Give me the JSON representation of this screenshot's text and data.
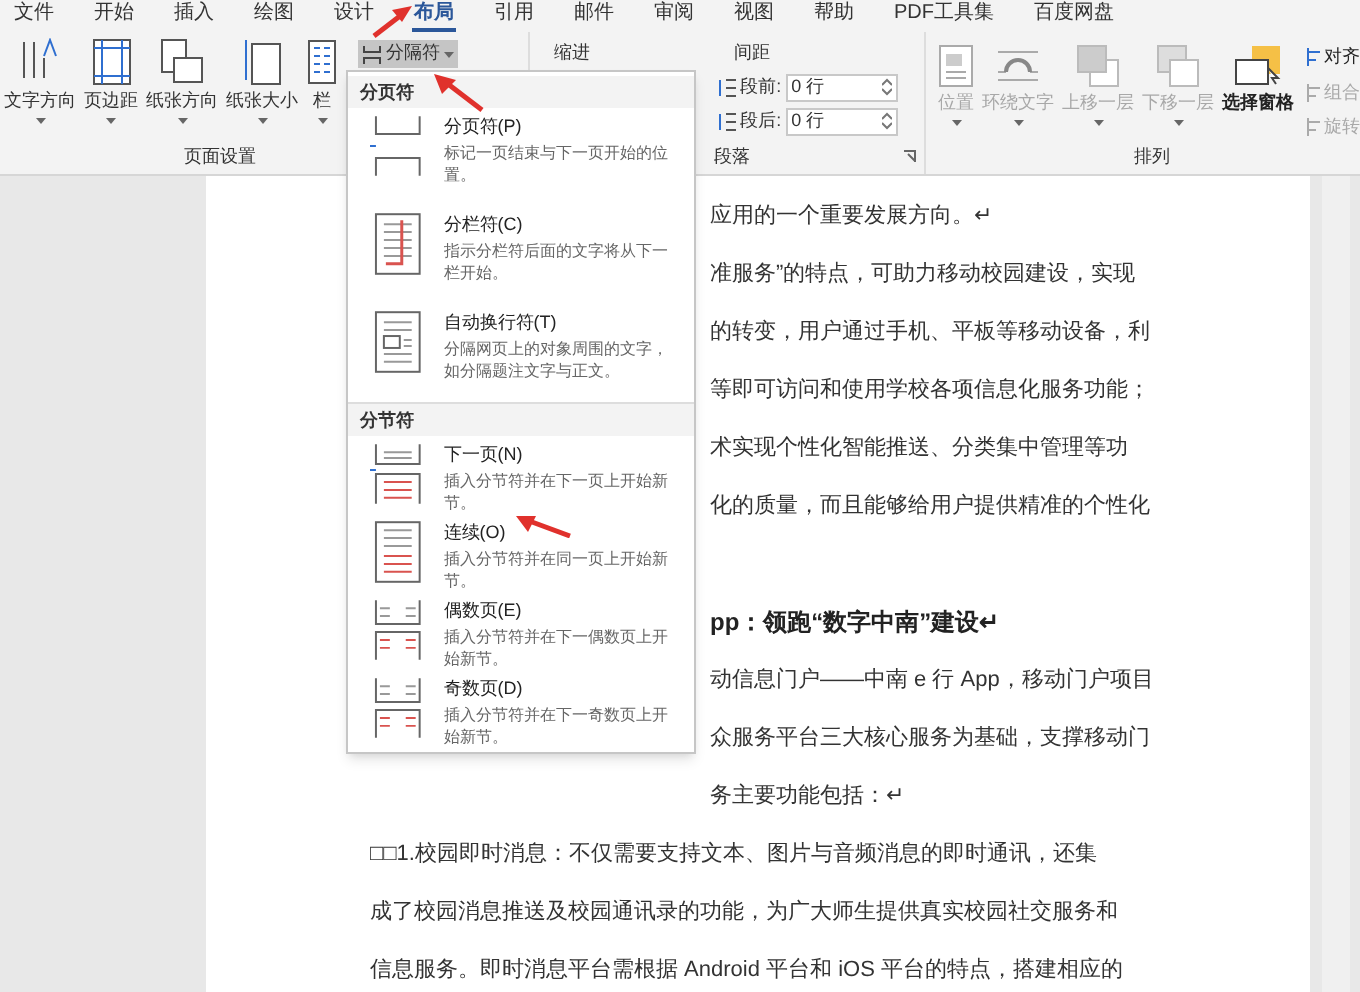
{
  "tabs": [
    {
      "label": "文件",
      "selected": false
    },
    {
      "label": "开始",
      "selected": false
    },
    {
      "label": "插入",
      "selected": false
    },
    {
      "label": "绘图",
      "selected": false
    },
    {
      "label": "设计",
      "selected": false
    },
    {
      "label": "布局",
      "selected": true
    },
    {
      "label": "引用",
      "selected": false
    },
    {
      "label": "邮件",
      "selected": false
    },
    {
      "label": "审阅",
      "selected": false
    },
    {
      "label": "视图",
      "selected": false
    },
    {
      "label": "帮助",
      "selected": false
    },
    {
      "label": "PDF工具集",
      "selected": false
    },
    {
      "label": "百度网盘",
      "selected": false
    }
  ],
  "page_setup": {
    "label": "页面设置",
    "buttons": [
      {
        "label": "文字方向",
        "kind": "text-direction"
      },
      {
        "label": "页边距",
        "kind": "margins"
      },
      {
        "label": "纸张方向",
        "kind": "orientation"
      },
      {
        "label": "纸张大小",
        "kind": "size"
      },
      {
        "label": "栏",
        "kind": "columns"
      }
    ],
    "breaks_button": {
      "label": "分隔符",
      "pressed": true
    }
  },
  "paragraph": {
    "label": "段落",
    "indent_label": "缩进",
    "spacing_label": "间距",
    "before": {
      "label": "段前:",
      "value": "0 行"
    },
    "after": {
      "label": "段后:",
      "value": "0 行"
    }
  },
  "arrange": {
    "label": "排列",
    "buttons": [
      {
        "label": "位置",
        "disabled": true,
        "kind": "position"
      },
      {
        "label": "环绕文字",
        "disabled": true,
        "kind": "wrap"
      },
      {
        "label": "上移一层",
        "disabled": true,
        "kind": "forward"
      },
      {
        "label": "下移一层",
        "disabled": true,
        "kind": "backward"
      },
      {
        "label": "选择窗格",
        "disabled": false,
        "kind": "pane"
      }
    ],
    "small": [
      {
        "label": "对齐",
        "disabled": false
      },
      {
        "label": "组合",
        "disabled": true
      },
      {
        "label": "旋转",
        "disabled": true
      }
    ]
  },
  "breaks_menu": {
    "sections": [
      {
        "title": "分页符",
        "items": [
          {
            "title": "分页符(P)",
            "description": "标记一页结束与下一页开始的位置。",
            "kind": "page"
          },
          {
            "title": "分栏符(C)",
            "description": "指示分栏符后面的文字将从下一栏开始。",
            "kind": "column"
          },
          {
            "title": "自动换行符(T)",
            "description": "分隔网页上的对象周围的文字，如分隔题注文字与正文。",
            "kind": "wrap"
          }
        ]
      },
      {
        "title": "分节符",
        "items": [
          {
            "title": "下一页(N)",
            "description": "插入分节符并在下一页上开始新节。",
            "kind": "next"
          },
          {
            "title": "连续(O)",
            "description": "插入分节符并在同一页上开始新节。",
            "kind": "continuous"
          },
          {
            "title": "偶数页(E)",
            "description": "插入分节符并在下一偶数页上开始新节。",
            "kind": "even"
          },
          {
            "title": "奇数页(D)",
            "description": "插入分节符并在下一奇数页上开始新节。",
            "kind": "odd"
          }
        ]
      }
    ]
  },
  "document": {
    "lines_beside_menu": [
      {
        "text": "应用的一个重要发展方向。↵",
        "kind": "body"
      },
      {
        "text": "准服务”的特点，可助力移动校园建设，实现",
        "kind": "body"
      },
      {
        "text": "的转变，用户通过手机、平板等移动设备，利",
        "kind": "body"
      },
      {
        "text": "等即可访问和使用学校各项信息化服务功能；",
        "kind": "body"
      },
      {
        "text": "术实现个性化智能推送、分类集中管理等功",
        "kind": "body"
      },
      {
        "text": "化的质量，而且能够给用户提供精准的个性化",
        "kind": "body"
      },
      {
        "kind": "blank"
      },
      {
        "text": "pp：领跑“数字中南”建设↵",
        "kind": "heading"
      },
      {
        "text": "动信息门户——中南 e 行 App，移动门户项目",
        "kind": "body"
      },
      {
        "text": "众服务平台三大核心服务为基础，支撑移动门",
        "kind": "body"
      },
      {
        "text": "务主要功能包括：↵",
        "kind": "body"
      }
    ],
    "lines": [
      "□□1.校园即时消息：不仅需要支持文本、图片与音频消息的即时通讯，还集",
      "成了校园消息推送及校园通讯录的功能，为广大师生提供真实校园社交服务和",
      "信息服务。即时消息平台需根据 Android 平台和 iOS 平台的特点，搭建相应的"
    ]
  }
}
